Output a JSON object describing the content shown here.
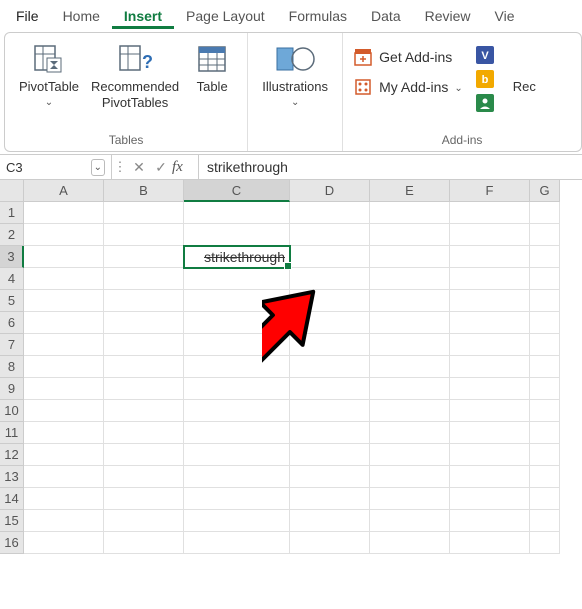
{
  "menu": {
    "tabs": [
      "File",
      "Home",
      "Insert",
      "Page Layout",
      "Formulas",
      "Data",
      "Review",
      "Vie"
    ],
    "active": "Insert"
  },
  "ribbon": {
    "tables": {
      "pivot": "PivotTable",
      "recommended": "Recommended\nPivotTables",
      "table": "Table",
      "group_label": "Tables"
    },
    "illustrations": {
      "label": "Illustrations"
    },
    "addins": {
      "get": "Get Add-ins",
      "my": "My Add-ins",
      "group_label": "Add-ins",
      "rec": "Rec"
    }
  },
  "formula_bar": {
    "name_box": "C3",
    "fx": "fx",
    "value": "strikethrough"
  },
  "grid": {
    "columns": [
      "A",
      "B",
      "C",
      "D",
      "E",
      "F",
      "G"
    ],
    "rows": [
      "1",
      "2",
      "3",
      "4",
      "5",
      "6",
      "7",
      "8",
      "9",
      "10",
      "11",
      "12",
      "13",
      "14",
      "15",
      "16"
    ],
    "active_col": "C",
    "active_row": "3",
    "cell_C3": "strikethrough"
  }
}
